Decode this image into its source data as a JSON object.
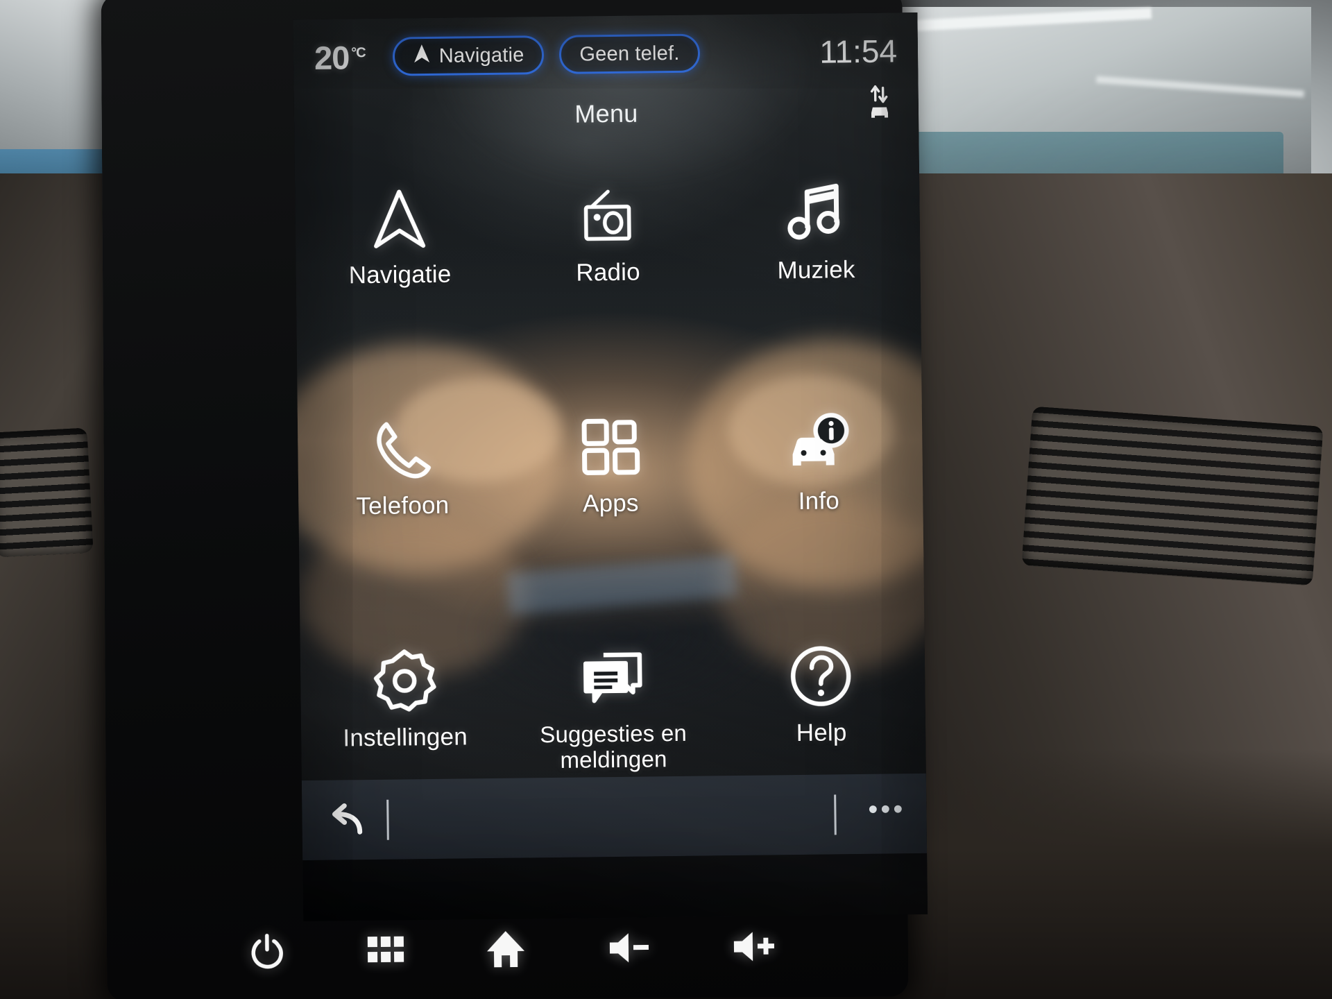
{
  "status_bar": {
    "temperature": "20",
    "temperature_unit": "°C",
    "nav_pill_label": "Navigatie",
    "phone_pill_label": "Geen telef.",
    "clock": "11:54",
    "car_status_icon": "car-up-down-arrows-icon"
  },
  "header": {
    "title": "Menu"
  },
  "menu": {
    "tiles": [
      {
        "label": "Navigatie",
        "icon": "navigation-arrow-icon"
      },
      {
        "label": "Radio",
        "icon": "radio-icon"
      },
      {
        "label": "Muziek",
        "icon": "music-note-icon"
      },
      {
        "label": "Telefoon",
        "icon": "phone-handset-icon"
      },
      {
        "label": "Apps",
        "icon": "apps-grid-icon"
      },
      {
        "label": "Info",
        "icon": "car-info-icon"
      },
      {
        "label": "Instellingen",
        "icon": "gear-icon"
      },
      {
        "label": "Suggesties en\nmeldingen",
        "icon": "chat-bubbles-icon"
      },
      {
        "label": "Help",
        "icon": "question-circle-icon"
      }
    ]
  },
  "soft_bar": {
    "back_icon": "back-arrow-icon",
    "more_label": "•••",
    "more_icon": "more-options-icon"
  },
  "hardware_bar": {
    "buttons": [
      {
        "icon": "power-icon",
        "name": "power-button"
      },
      {
        "icon": "apps-grid-icon",
        "name": "apps-button"
      },
      {
        "icon": "home-icon",
        "name": "home-button"
      },
      {
        "icon": "volume-down-icon",
        "name": "volume-down-button"
      },
      {
        "icon": "volume-up-icon",
        "name": "volume-up-button"
      }
    ]
  },
  "colors": {
    "pill_border": "#2f6fe8",
    "text": "#ffffff",
    "screen_bg": "#1b1f21",
    "softbar_bg": "#242a32"
  }
}
